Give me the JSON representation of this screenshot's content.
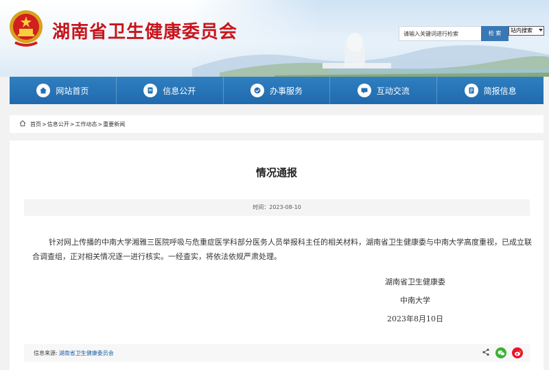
{
  "header": {
    "site_title": "湖南省卫生健康委员会",
    "search_placeholder": "请输入关键词进行检索",
    "search_button": "检 索",
    "search_scope": "站内搜索"
  },
  "nav": {
    "items": [
      {
        "label": "网站首页",
        "icon": "home-icon"
      },
      {
        "label": "信息公开",
        "icon": "document-icon"
      },
      {
        "label": "办事服务",
        "icon": "service-icon"
      },
      {
        "label": "互动交流",
        "icon": "chat-icon"
      },
      {
        "label": "简报信息",
        "icon": "report-icon"
      }
    ]
  },
  "breadcrumb": {
    "home": "首页",
    "info": "信息公开",
    "work": "工作动态",
    "news": "重要新闻",
    "separator": ">"
  },
  "article": {
    "title": "情况通报",
    "time_label": "时间：",
    "time_value": "2023-08-10",
    "body": "针对网上传播的中南大学湘雅三医院呼吸与危重症医学科部分医务人员举报科主任的相关材料，湖南省卫生健康委与中南大学高度重视，已成立联合调查组，正对相关情况逐一进行核实。一经查实，将依法依规严肃处理。",
    "signature_1": "湖南省卫生健康委",
    "signature_2": "中南大学",
    "signature_date": "2023年8月10日"
  },
  "source": {
    "label": "信息来源:",
    "value": "湖南省卫生健康委员会"
  },
  "colors": {
    "title_red": "#c8141b",
    "nav_blue": "#2371b2",
    "link_blue": "#1a5fa8",
    "wechat_green": "#3cb034",
    "weibo_red": "#e6162d"
  }
}
